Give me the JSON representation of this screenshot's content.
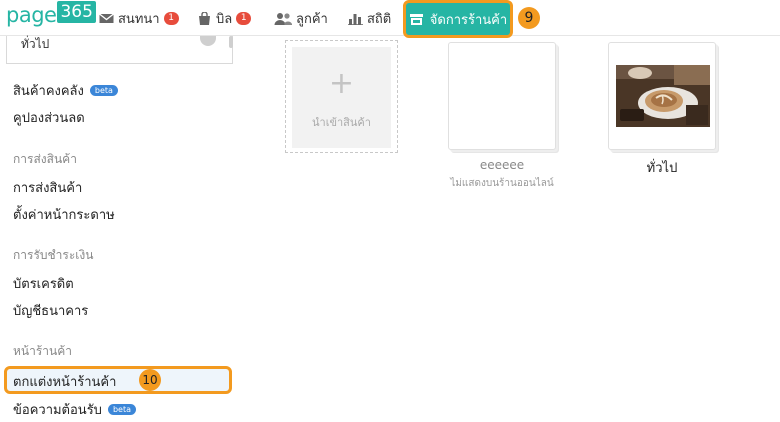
{
  "brand": {
    "logo_text": "page",
    "logo_number": "365",
    "accent": "#26b5a4",
    "highlight": "#f39a1f"
  },
  "nav": {
    "chat": {
      "label": "สนทนา",
      "badge": "1",
      "icon": "envelope-icon"
    },
    "bill": {
      "label": "บิล",
      "badge": "1",
      "icon": "shopping-bag-icon"
    },
    "customers": {
      "label": "ลูกค้า",
      "icon": "users-icon"
    },
    "stats": {
      "label": "สถิติ",
      "icon": "bar-chart-icon"
    },
    "store": {
      "label": "จัดการร้านค้า",
      "icon": "storefront-icon",
      "step": "9"
    }
  },
  "sidebar": {
    "category_select": {
      "value": "ทั่วไป"
    },
    "items_top": [
      {
        "label": "สินค้าคงคลัง",
        "badge": "beta"
      },
      {
        "label": "คูปองส่วนลด"
      }
    ],
    "shipping": {
      "heading": "การส่งสินค้า",
      "items": [
        "การส่งสินค้า",
        "ตั้งค่าหน้ากระดาษ"
      ]
    },
    "payment": {
      "heading": "การรับชำระเงิน",
      "items": [
        "บัตรเครดิต",
        "บัญชีธนาคาร"
      ]
    },
    "storefront": {
      "heading": "หน้าร้านค้า",
      "items": [
        {
          "label": "ตกแต่งหน้าร้านค้า",
          "step": "10"
        },
        {
          "label": "ข้อความต้อนรับ",
          "badge": "beta"
        }
      ]
    }
  },
  "main": {
    "import_card": {
      "label": "นำเข้าสินค้า"
    },
    "categories": [
      {
        "name": "eeeeee",
        "note": "ไม่แสดงบนร้านออนไลน์"
      },
      {
        "name": "ทั่วไป"
      }
    ]
  }
}
